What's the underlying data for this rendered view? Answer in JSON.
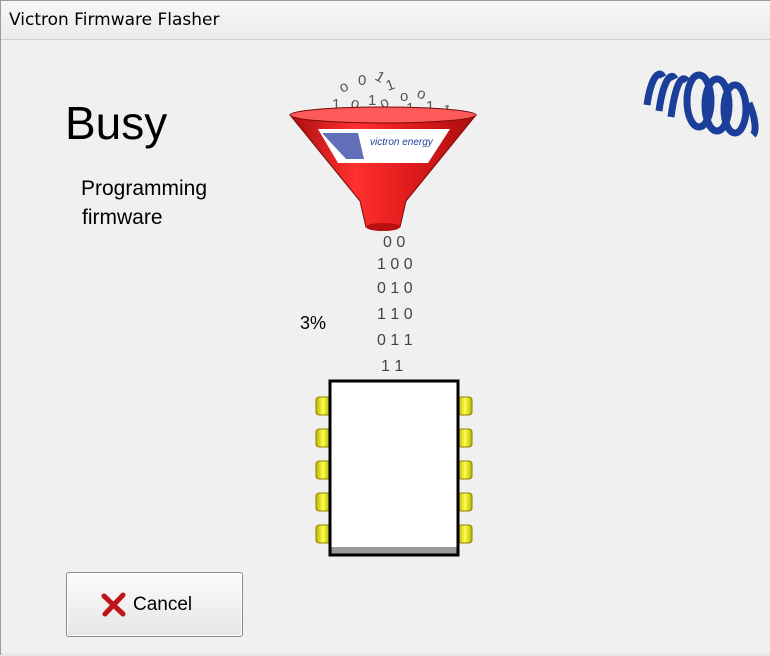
{
  "window": {
    "title": "Victron Firmware Flasher"
  },
  "status": {
    "heading": "Busy",
    "message_line1": "Programming",
    "message_line2": "firmware",
    "progress_text": "3%",
    "progress_fraction": 0.03
  },
  "funnel": {
    "brand_text": "victron energy"
  },
  "stream": {
    "bits": [
      "0 0",
      "1 0 0",
      "0 1 0",
      "1 1 0",
      "0 1 1",
      "1 1"
    ]
  },
  "buttons": {
    "cancel_label": "Cancel"
  },
  "icons": {
    "cancel": "close-icon",
    "logo": "victron-logo-icon",
    "chip": "chip-icon",
    "funnel": "funnel-icon"
  },
  "colors": {
    "funnel_red": "#e01b1b",
    "logo_blue": "#1a3e9a",
    "chip_pins": "#e8e020",
    "cancel_x": "#c0141a"
  }
}
